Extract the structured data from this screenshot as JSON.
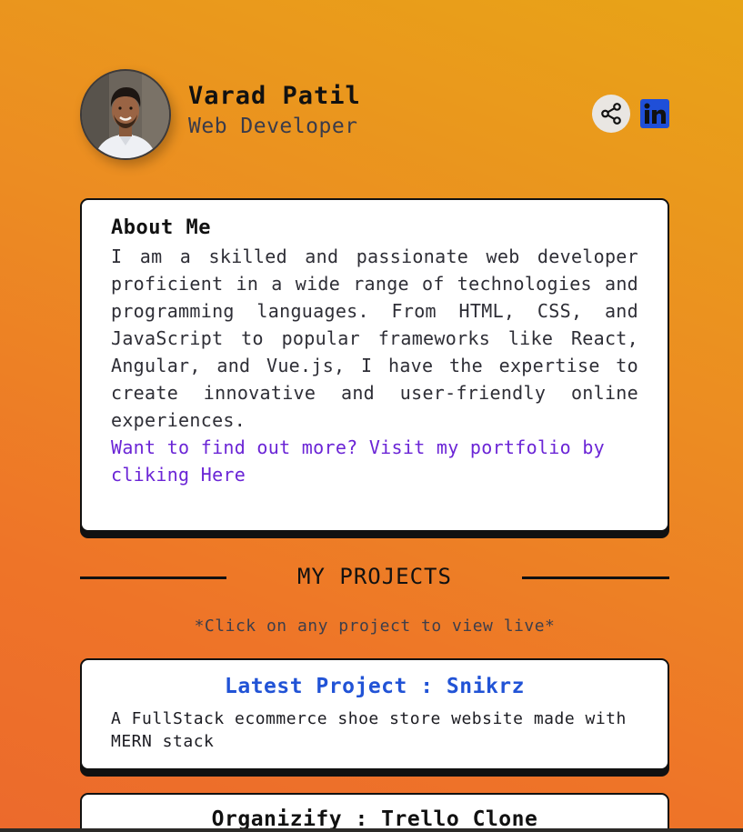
{
  "profile": {
    "name": "Varad Patil",
    "role": "Web Developer"
  },
  "social": {
    "share_icon": "share-icon",
    "linkedin_icon": "linkedin-icon",
    "linkedin_color": "#1f4fd8"
  },
  "about": {
    "title": "About Me",
    "text": "I am a skilled and passionate web developer proficient in a wide range of technologies and programming languages. From HTML, CSS, and JavaScript to popular frameworks like React, Angular, and Vue.js, I have the expertise to create innovative and user-friendly online experiences.",
    "link_text": "Want to find out more? Visit my portfolio by cliking Here"
  },
  "projects": {
    "heading": "MY PROJECTS",
    "hint": "*Click on any project to view live*",
    "items": [
      {
        "title": "Latest Project : Snikrz",
        "description": "A FullStack ecommerce shoe store website made with MERN stack"
      },
      {
        "title": "Organizify : Trello Clone"
      }
    ]
  },
  "colors": {
    "accent_link": "#6b25d6",
    "project_title": "#2153d6",
    "background_top": "#e8a417",
    "background_bottom": "#ec6a2c"
  }
}
